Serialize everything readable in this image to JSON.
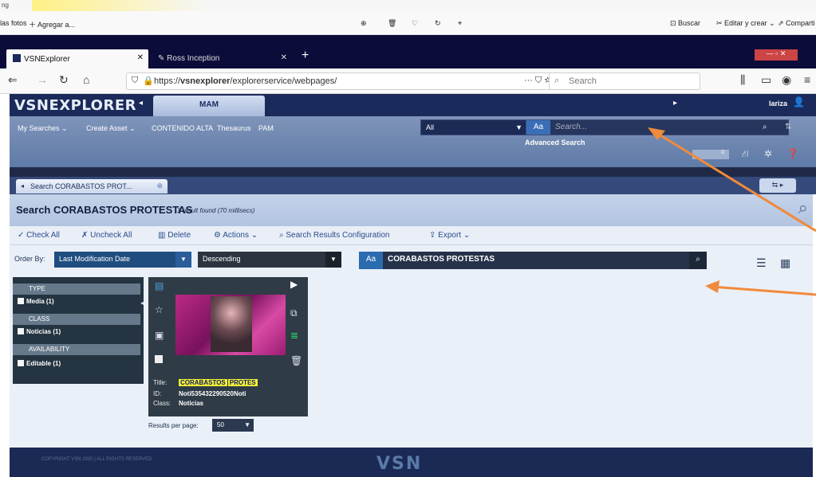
{
  "os": {
    "top_left": "ng"
  },
  "bookmarks": {
    "item1": "las fotos",
    "item2": "Agregar a...",
    "buscar": "Buscar",
    "editar": "Editar y crear",
    "compartir": "Comparti"
  },
  "tabs": [
    {
      "label": "VSNExplorer"
    },
    {
      "label": "Ross Inception"
    }
  ],
  "browser": {
    "url_prefix": "https://",
    "url_domain": "vsnexplorer",
    "url_path": "/explorerservice/webpages/",
    "search_placeholder": "Search"
  },
  "app": {
    "logo": "VSNEXPLORER",
    "mam_tab": "MAM",
    "user": "lariza",
    "menu": [
      "My Searches",
      "Create Asset",
      "CONTENIDO ALTA",
      "Thesaurus",
      "PAM"
    ],
    "scope": "All",
    "search_placeholder": "Search...",
    "advanced_search": "Advanced Search",
    "counter": "0",
    "aa": "Aa"
  },
  "breadcrumb": "Search CORABASTOS PROT...",
  "search_title": "Search CORABASTOS PROTESTAS",
  "result_info": "1 result found (70 millisecs)",
  "actions": {
    "check_all": "Check All",
    "uncheck_all": "Uncheck All",
    "delete": "Delete",
    "actions": "Actions",
    "config": "Search Results Configuration",
    "export": "Export"
  },
  "order": {
    "label": "Order By:",
    "field": "Last Modification Date",
    "direction": "Descending",
    "query": "CORABASTOS PROTESTAS"
  },
  "facets": [
    {
      "head": "TYPE",
      "item": "Media (1)"
    },
    {
      "head": "CLASS",
      "item": "Noticias (1)"
    },
    {
      "head": "AVAILABILITY",
      "item": "Editable (1)"
    }
  ],
  "card": {
    "title_label": "Title:",
    "title_value_a": "CORABASTOS",
    "title_value_b": "PROTES",
    "id_label": "ID:",
    "id_value": "Noti535432290520Noti",
    "class_label": "Class:",
    "class_value": "Noticias"
  },
  "results_per_page": {
    "label": "Results per page:",
    "value": "50"
  },
  "footer": {
    "copyright": "COPYRIGHT VSN 2020 | ALL RIGHTS RESERVED",
    "brand": "VSN"
  },
  "colors": {
    "annotation_arrow": "#f08a3c",
    "highlight": "#f8f232",
    "header": "#1a2a5a"
  }
}
